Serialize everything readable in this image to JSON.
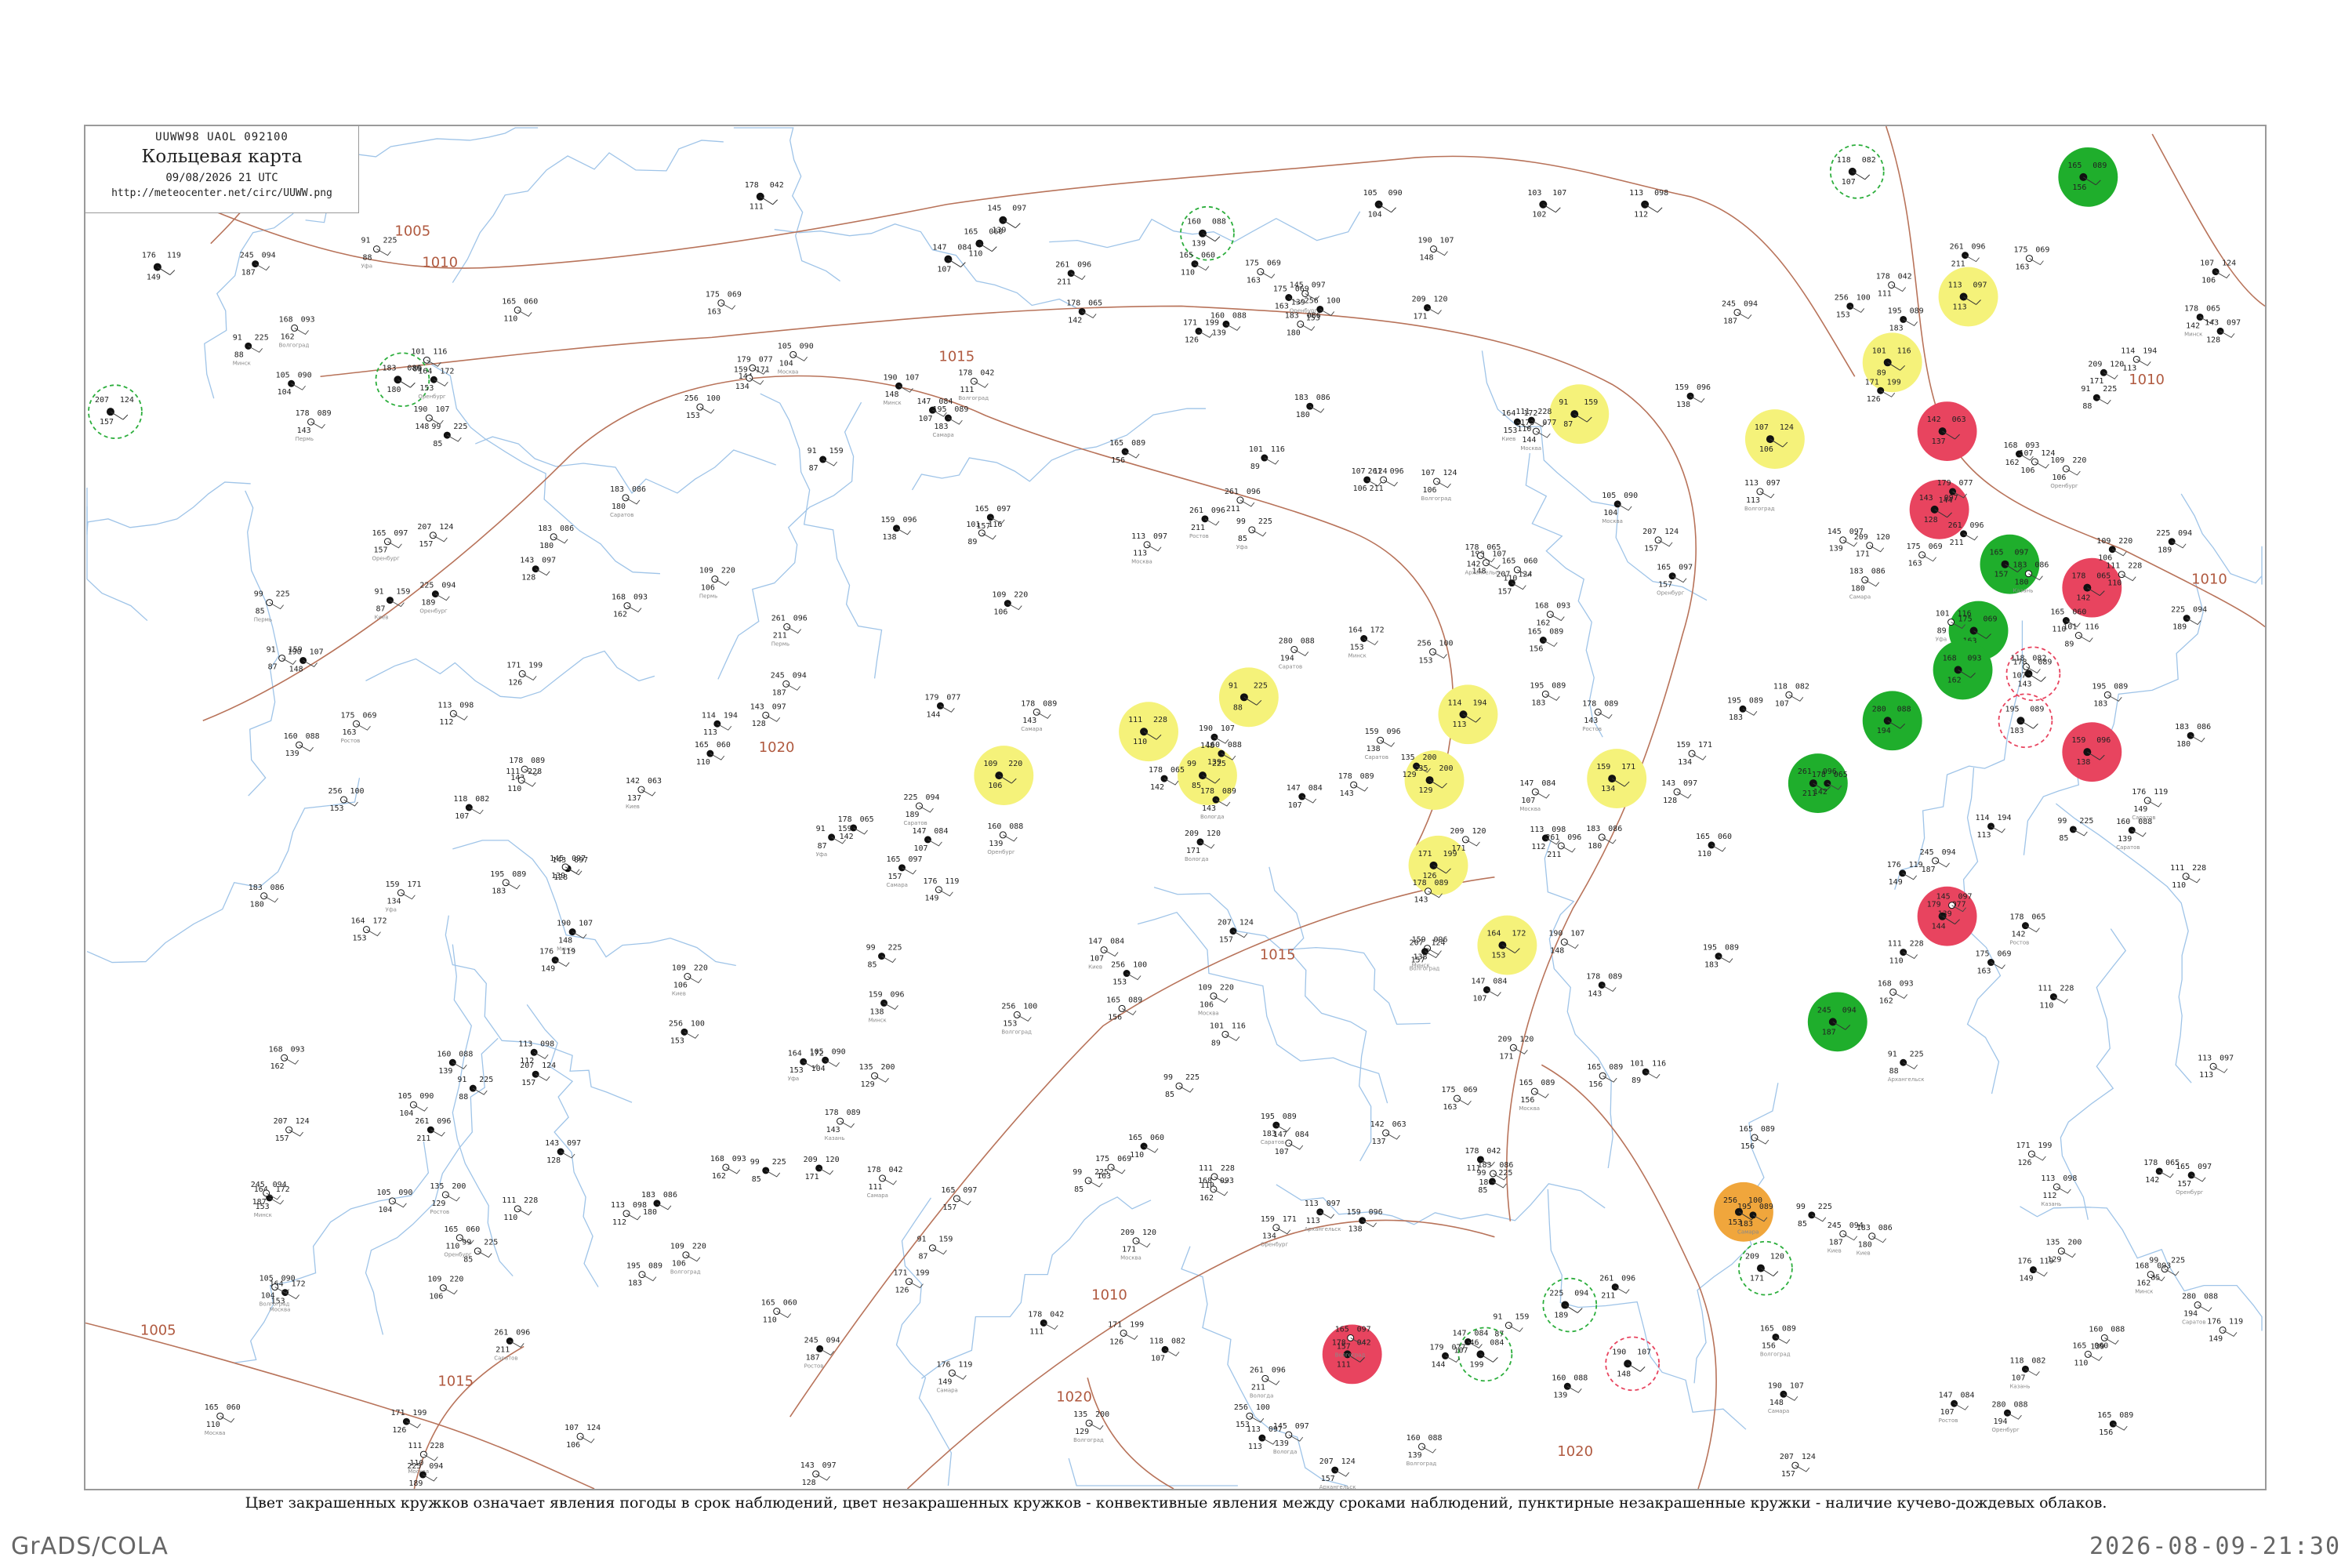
{
  "header": {
    "bulletin": "UUWW98  UAOL  092100",
    "title": "Кольцевая карта",
    "date": "09/08/2026 21 UTC",
    "url": "http://meteocenter.net/circ/UUWW.png"
  },
  "caption": "Цвет закрашенных кружков означает явления погоды в срок наблюдений, цвет незакрашенных кружков - конвективные явления между сроками наблюдений, пунктирные незакрашенные кружки - наличие кучево-дождевых облаков.",
  "footer": {
    "software": "GrADS/COLA",
    "timestamp": "2026-08-09-21:30"
  },
  "colors": {
    "isobar": "#b8735a",
    "river": "#9fc4e8",
    "fog": "#f5f27a",
    "thunder": "#e8445f",
    "rain": "#1fae2c",
    "haze": "#f0a63c",
    "cb": "#2cae3c"
  },
  "isobars": [
    {
      "label": "1005"
    },
    {
      "label": "1010"
    },
    {
      "label": "1015"
    },
    {
      "label": "1020"
    }
  ],
  "stations": [
    {
      "temp": "178",
      "pres": "042",
      "dew": "111"
    },
    {
      "temp": "145",
      "pres": "097",
      "dew": "139"
    },
    {
      "temp": "103",
      "pres": "107",
      "dew": "102"
    },
    {
      "temp": "165",
      "pres": "060",
      "dew": "110"
    },
    {
      "temp": "147",
      "pres": "084",
      "dew": "107"
    },
    {
      "temp": "160",
      "pres": "088",
      "dew": "139"
    },
    {
      "temp": "105",
      "pres": "090",
      "dew": "104"
    },
    {
      "temp": "113",
      "pres": "098",
      "dew": "112"
    },
    {
      "temp": "118",
      "pres": "082",
      "dew": "107"
    },
    {
      "temp": "165",
      "pres": "089",
      "dew": "156"
    },
    {
      "temp": "183",
      "pres": "086",
      "dew": "180"
    },
    {
      "temp": "176",
      "pres": "119",
      "dew": "149"
    },
    {
      "temp": "207",
      "pres": "124",
      "dew": "157"
    },
    {
      "temp": "91",
      "pres": "159",
      "dew": "87"
    },
    {
      "temp": "101",
      "pres": "116",
      "dew": "89"
    },
    {
      "temp": "113",
      "pres": "097",
      "dew": "113"
    },
    {
      "temp": "107",
      "pres": "124",
      "dew": "106"
    },
    {
      "temp": "91",
      "pres": "225",
      "dew": "88"
    },
    {
      "temp": "111",
      "pres": "228",
      "dew": "110"
    },
    {
      "temp": "99",
      "pres": "225",
      "dew": "85"
    },
    {
      "temp": "109",
      "pres": "220",
      "dew": "106"
    },
    {
      "temp": "114",
      "pres": "194",
      "dew": "113"
    },
    {
      "temp": "135",
      "pres": "200",
      "dew": "129"
    },
    {
      "temp": "159",
      "pres": "171",
      "dew": "134"
    },
    {
      "temp": "171",
      "pres": "199",
      "dew": "126"
    },
    {
      "temp": "164",
      "pres": "172",
      "dew": "153"
    },
    {
      "temp": "142",
      "pres": "063",
      "dew": "137"
    },
    {
      "temp": "143",
      "pres": "097",
      "dew": "128"
    },
    {
      "temp": "165",
      "pres": "097",
      "dew": "157"
    },
    {
      "temp": "178",
      "pres": "065",
      "dew": "142"
    },
    {
      "temp": "175",
      "pres": "069",
      "dew": "163"
    },
    {
      "temp": "168",
      "pres": "093",
      "dew": "162"
    },
    {
      "temp": "178",
      "pres": "089",
      "dew": "143"
    },
    {
      "temp": "195",
      "pres": "089",
      "dew": "183"
    },
    {
      "temp": "159",
      "pres": "096",
      "dew": "138"
    },
    {
      "temp": "261",
      "pres": "096",
      "dew": "211"
    },
    {
      "temp": "179",
      "pres": "077",
      "dew": "144"
    },
    {
      "temp": "245",
      "pres": "094",
      "dew": "187"
    },
    {
      "temp": "280",
      "pres": "088",
      "dew": "194"
    },
    {
      "temp": "256",
      "pres": "100",
      "dew": "153"
    },
    {
      "temp": "209",
      "pres": "120",
      "dew": "171"
    },
    {
      "temp": "225",
      "pres": "094",
      "dew": "189"
    },
    {
      "temp": "246",
      "pres": "084",
      "dew": "199"
    },
    {
      "temp": "190",
      "pres": "107",
      "dew": "148"
    }
  ],
  "station_names": [
    "Архангельск",
    "Москва",
    "Вологда",
    "Минск",
    "Киев",
    "Казань",
    "Самара",
    "Пермь",
    "Уфа",
    "Саратов",
    "Волгоград",
    "Ростов",
    "Оренбург"
  ]
}
